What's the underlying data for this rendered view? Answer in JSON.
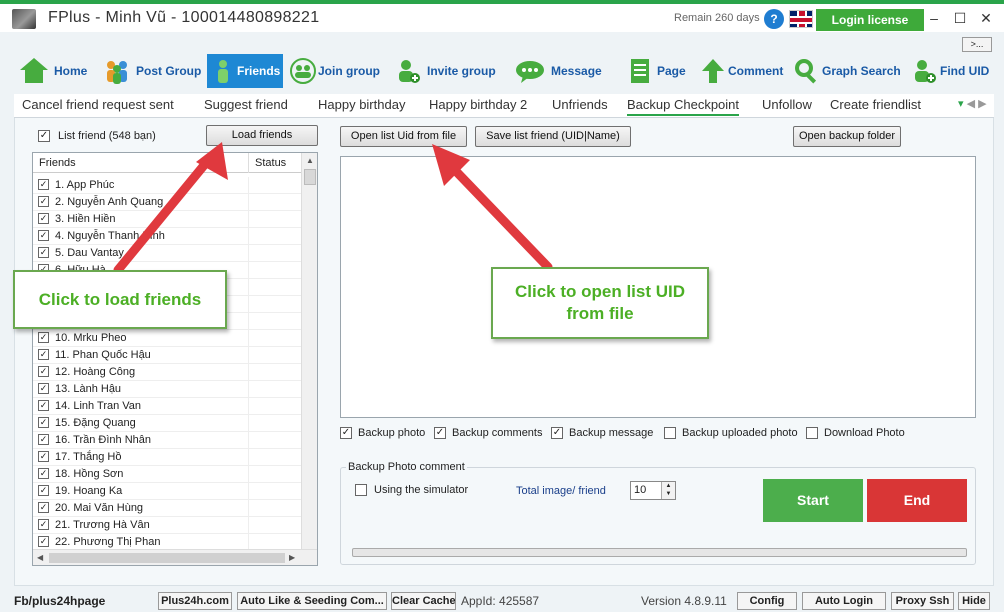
{
  "window": {
    "title": "FPlus - Minh Vũ - 100014480898221",
    "remain": "Remain 260 days",
    "help_glyph": "?",
    "login_license": "Login license",
    "minimize": "–",
    "maximize": "☐",
    "close": "✕",
    "more": ">..."
  },
  "toolbar": [
    {
      "label": "Home",
      "icon": "home-icon"
    },
    {
      "label": "Post Group",
      "icon": "group-icon"
    },
    {
      "label": "Friends",
      "icon": "friend-icon"
    },
    {
      "label": "Join group",
      "icon": "join-group-icon"
    },
    {
      "label": "Invite group",
      "icon": "invite-icon"
    },
    {
      "label": "Message",
      "icon": "message-icon"
    },
    {
      "label": "Page",
      "icon": "page-icon"
    },
    {
      "label": "Comment",
      "icon": "comment-arrow-icon"
    },
    {
      "label": "Graph Search",
      "icon": "search-icon"
    },
    {
      "label": "Find UID",
      "icon": "find-uid-icon"
    }
  ],
  "tabs": [
    "Cancel friend request sent",
    "Suggest friend",
    "Happy birthday",
    "Happy birthday 2",
    "Unfriends",
    "Backup Checkpoint",
    "Unfollow",
    "Create friendlist"
  ],
  "active_tab": "Backup Checkpoint",
  "friends_panel": {
    "list_friend_label": "List friend (548 bạn)",
    "load_button": "Load friends",
    "col_friends": "Friends",
    "col_status": "Status",
    "rows": [
      "1. App Phúc",
      "2. Nguyễn Anh Quang",
      "3. Hiền Hiền",
      "4. Nguyễn Thanh Bình",
      "5. Dau Vantay",
      "6. Hữu Hà",
      "7.",
      "8.",
      "9.",
      "10. Mrku Pheo",
      "11. Phan Quốc Hậu",
      "12. Hoàng Công",
      "13. Lành Hậu",
      "14. Linh Tran Van",
      "15. Đặng Quang",
      "16. Trần Đình Nhân",
      "17. Thắng Hồ",
      "18. Hồng Sơn",
      "19. Hoang Ka",
      "20. Mai Văn Hùng",
      "21. Trương Hà Vân",
      "22. Phương Thị Phan"
    ]
  },
  "right_panel": {
    "open_list_button": "Open list Uid from file",
    "save_list_button": "Save list friend (UID|Name)",
    "open_backup_button": "Open backup folder",
    "options": [
      {
        "label": "Backup photo",
        "checked": true
      },
      {
        "label": "Backup comments",
        "checked": true
      },
      {
        "label": "Backup message",
        "checked": true
      },
      {
        "label": "Backup uploaded photo",
        "checked": false
      },
      {
        "label": "Download Photo",
        "checked": false
      }
    ],
    "group_title": "Backup Photo  comment",
    "simulator_label": "Using the simulator",
    "total_label": "Total image/ friend",
    "total_value": "10",
    "start": "Start",
    "end": "End"
  },
  "callouts": {
    "load": "Click to load friends",
    "open_line1": "Click to open list UID",
    "open_line2": "from file"
  },
  "statusbar": {
    "fb": "Fb/plus24hpage",
    "plus24h": "Plus24h.com",
    "auto_like": "Auto Like & Seeding Com...",
    "clear_cache": "Clear Cache",
    "appid": "AppId: 425587",
    "version": "Version 4.8.9.11",
    "config": "Config",
    "auto_login": "Auto Login",
    "proxy": "Proxy Ssh",
    "hide": "Hide"
  },
  "colors": {
    "accent_green": "#2aa44a",
    "active_tab_blue": "#1e88d4",
    "start_green": "#4cae4c",
    "end_red": "#d93636",
    "callout_arrow_red": "#e0393e"
  }
}
